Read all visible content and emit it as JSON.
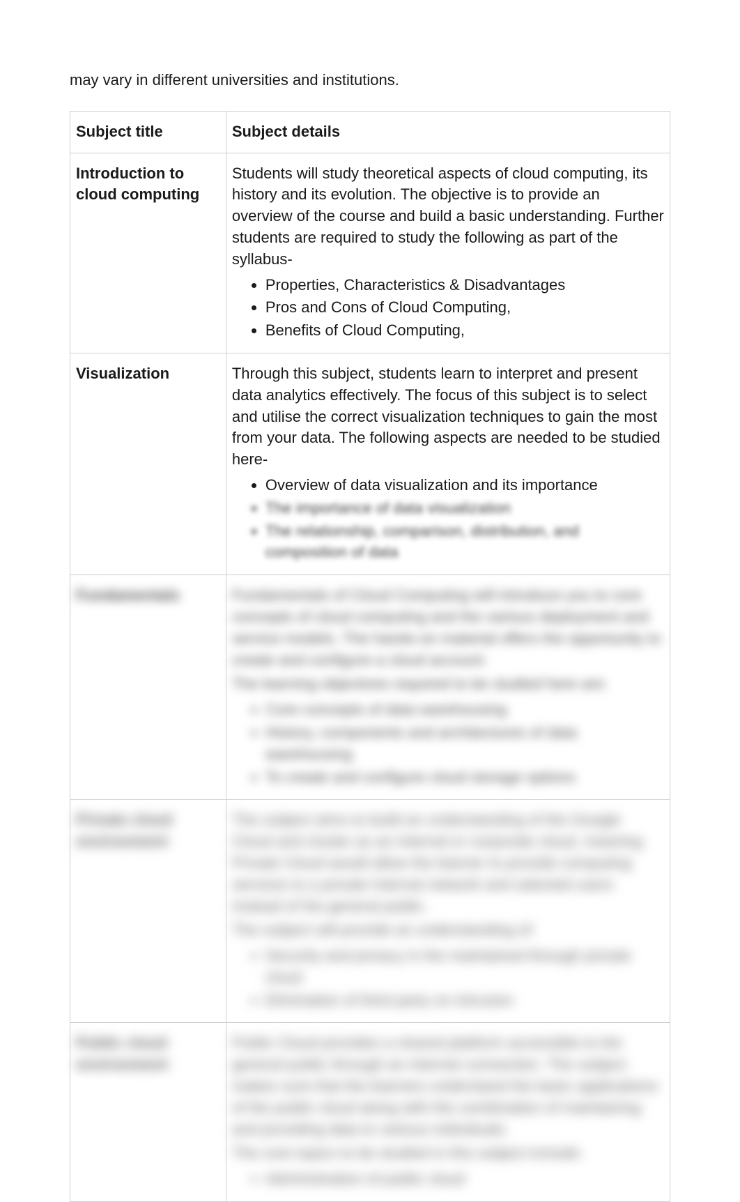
{
  "intro": "may vary in different universities and institutions.",
  "headers": {
    "subject_title": "Subject title",
    "subject_details": "Subject details"
  },
  "rows": [
    {
      "title": "Introduction to cloud computing",
      "blurLevel": 0,
      "details_para": "Students will study theoretical aspects of cloud computing, its history and its evolution. The objective is to provide an overview of the course and build a basic understanding. Further students are required to study the following as part of the syllabus-",
      "bullets": [
        "Properties, Characteristics & Disadvantages",
        "Pros and Cons of Cloud Computing,",
        "Benefits of Cloud Computing,"
      ]
    },
    {
      "title": "Visualization",
      "blurLevel": 0,
      "details_para": "Through this subject, students learn to interpret and present data analytics effectively. The focus of this subject is to select and utilise the correct visualization techniques to gain the most from your data. The following aspects are needed to be studied here-",
      "bullets": [
        "Overview of data visualization and its importance",
        "The importance of data visualization",
        "The relationship, comparison, distribution, and composition of data"
      ],
      "bullet_blur_from": 1
    },
    {
      "title": "Fundamentals",
      "blurLevel": 2,
      "details_para": "Fundamentals of Cloud Computing will introduce you to core concepts of cloud computing and the various deployment and service models. The hands-on material offers the opportunity to create and configure a cloud account.",
      "details_para2": "The learning objectives required to be studied here are:",
      "bullets": [
        "Core concepts of data warehousing",
        "History, components and architectures of data warehousing",
        "To create and configure cloud storage options"
      ]
    },
    {
      "title": "Private cloud environment",
      "blurLevel": 3,
      "details_para": "The subject aims to build an understanding of the Google Cloud and cluster as an internal or corporate cloud, meaning Private Cloud would allow the learner to provide computing services to a private internal network and selected users instead of the general public.",
      "details_para2": "The subject will provide an understanding of:",
      "bullets": [
        "Security and privacy in the maintained through private cloud",
        "Elimination of third party on intrusion"
      ]
    },
    {
      "title": "Public cloud environment",
      "blurLevel": 3,
      "details_para": "Public Cloud provides a shared platform accessible to the general public through an internet connection. The subject makes sure that the learners understand the basic applications of the public cloud along with the combination of maintaining and providing data to various individuals.",
      "details_para2": "The core topics to be studied in this subject include:",
      "bullets": [
        "Administration of public cloud"
      ]
    }
  ]
}
